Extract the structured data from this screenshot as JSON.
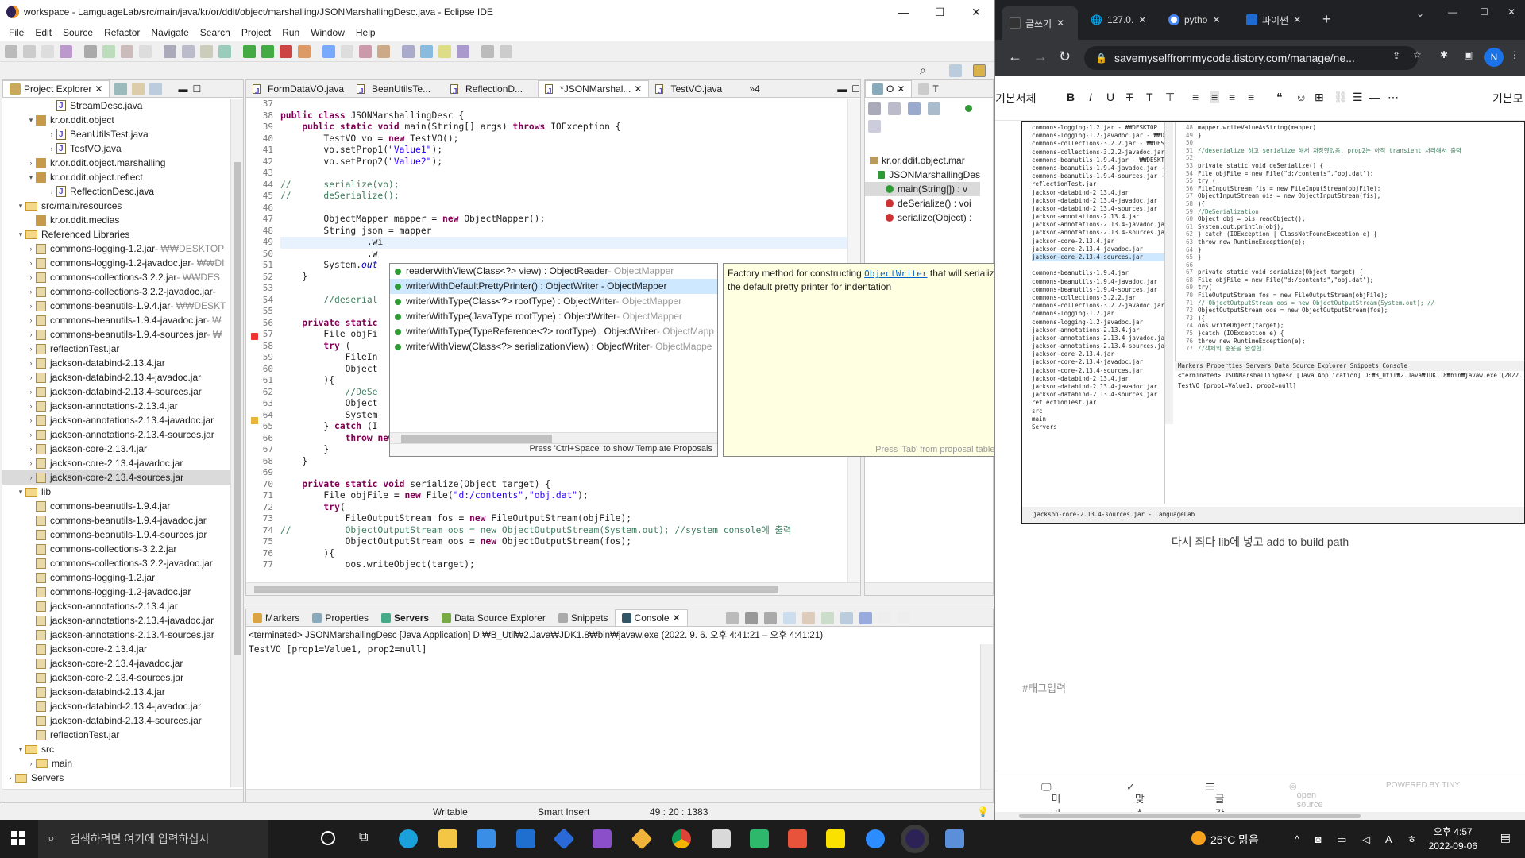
{
  "eclipse": {
    "title": "workspace - LamguageLab/src/main/java/kr/or/ddit/object/marshalling/JSONMarshallingDesc.java - Eclipse IDE",
    "menu": [
      "File",
      "Edit",
      "Source",
      "Refactor",
      "Navigate",
      "Search",
      "Project",
      "Run",
      "Window",
      "Help"
    ],
    "explorer": {
      "title": "Project Explorer",
      "rows": [
        {
          "indent": 4,
          "tw": "",
          "icon": "jfile",
          "label": "StreamDesc.java",
          "suffix": ""
        },
        {
          "indent": 2,
          "tw": "▾",
          "icon": "pkg",
          "label": "kr.or.ddit.object",
          "suffix": ""
        },
        {
          "indent": 4,
          "tw": "›",
          "icon": "jfile",
          "label": "BeanUtilsTest.java",
          "suffix": ""
        },
        {
          "indent": 4,
          "tw": "›",
          "icon": "jfile",
          "label": "TestVO.java",
          "suffix": ""
        },
        {
          "indent": 2,
          "tw": "›",
          "icon": "pkg",
          "label": "kr.or.ddit.object.marshalling",
          "suffix": ""
        },
        {
          "indent": 2,
          "tw": "▾",
          "icon": "pkg",
          "label": "kr.or.ddit.object.reflect",
          "suffix": ""
        },
        {
          "indent": 4,
          "tw": "›",
          "icon": "jfile",
          "label": "ReflectionDesc.java",
          "suffix": ""
        },
        {
          "indent": 1,
          "tw": "▾",
          "icon": "fold",
          "label": "src/main/resources",
          "suffix": ""
        },
        {
          "indent": 2,
          "tw": "",
          "icon": "pkg",
          "label": "kr.or.ddit.medias",
          "suffix": ""
        },
        {
          "indent": 1,
          "tw": "▾",
          "icon": "fold",
          "label": "Referenced Libraries",
          "suffix": ""
        },
        {
          "indent": 2,
          "tw": "›",
          "icon": "jar",
          "label": "commons-logging-1.2.jar",
          "suffix": " - ₩₩DESKTOP"
        },
        {
          "indent": 2,
          "tw": "›",
          "icon": "jar",
          "label": "commons-logging-1.2-javadoc.jar",
          "suffix": " - ₩₩DI"
        },
        {
          "indent": 2,
          "tw": "›",
          "icon": "jar",
          "label": "commons-collections-3.2.2.jar",
          "suffix": " - ₩₩DES"
        },
        {
          "indent": 2,
          "tw": "›",
          "icon": "jar",
          "label": "commons-collections-3.2.2-javadoc.jar",
          "suffix": " -"
        },
        {
          "indent": 2,
          "tw": "›",
          "icon": "jar",
          "label": "commons-beanutils-1.9.4.jar",
          "suffix": " - ₩₩DESKT"
        },
        {
          "indent": 2,
          "tw": "›",
          "icon": "jar",
          "label": "commons-beanutils-1.9.4-javadoc.jar",
          "suffix": " - ₩"
        },
        {
          "indent": 2,
          "tw": "›",
          "icon": "jar",
          "label": "commons-beanutils-1.9.4-sources.jar",
          "suffix": " - ₩"
        },
        {
          "indent": 2,
          "tw": "›",
          "icon": "jar",
          "label": "reflectionTest.jar",
          "suffix": ""
        },
        {
          "indent": 2,
          "tw": "›",
          "icon": "jar",
          "label": "jackson-databind-2.13.4.jar",
          "suffix": ""
        },
        {
          "indent": 2,
          "tw": "›",
          "icon": "jar",
          "label": "jackson-databind-2.13.4-javadoc.jar",
          "suffix": ""
        },
        {
          "indent": 2,
          "tw": "›",
          "icon": "jar",
          "label": "jackson-databind-2.13.4-sources.jar",
          "suffix": ""
        },
        {
          "indent": 2,
          "tw": "›",
          "icon": "jar",
          "label": "jackson-annotations-2.13.4.jar",
          "suffix": ""
        },
        {
          "indent": 2,
          "tw": "›",
          "icon": "jar",
          "label": "jackson-annotations-2.13.4-javadoc.jar",
          "suffix": ""
        },
        {
          "indent": 2,
          "tw": "›",
          "icon": "jar",
          "label": "jackson-annotations-2.13.4-sources.jar",
          "suffix": ""
        },
        {
          "indent": 2,
          "tw": "›",
          "icon": "jar",
          "label": "jackson-core-2.13.4.jar",
          "suffix": ""
        },
        {
          "indent": 2,
          "tw": "›",
          "icon": "jar",
          "label": "jackson-core-2.13.4-javadoc.jar",
          "suffix": ""
        },
        {
          "indent": 2,
          "tw": "›",
          "icon": "jar",
          "label": "jackson-core-2.13.4-sources.jar",
          "suffix": "",
          "sel": true
        },
        {
          "indent": 1,
          "tw": "▾",
          "icon": "fold",
          "label": "lib",
          "suffix": ""
        },
        {
          "indent": 2,
          "tw": "",
          "icon": "jar",
          "label": "commons-beanutils-1.9.4.jar",
          "suffix": ""
        },
        {
          "indent": 2,
          "tw": "",
          "icon": "jar",
          "label": "commons-beanutils-1.9.4-javadoc.jar",
          "suffix": ""
        },
        {
          "indent": 2,
          "tw": "",
          "icon": "jar",
          "label": "commons-beanutils-1.9.4-sources.jar",
          "suffix": ""
        },
        {
          "indent": 2,
          "tw": "",
          "icon": "jar",
          "label": "commons-collections-3.2.2.jar",
          "suffix": ""
        },
        {
          "indent": 2,
          "tw": "",
          "icon": "jar",
          "label": "commons-collections-3.2.2-javadoc.jar",
          "suffix": ""
        },
        {
          "indent": 2,
          "tw": "",
          "icon": "jar",
          "label": "commons-logging-1.2.jar",
          "suffix": ""
        },
        {
          "indent": 2,
          "tw": "",
          "icon": "jar",
          "label": "commons-logging-1.2-javadoc.jar",
          "suffix": ""
        },
        {
          "indent": 2,
          "tw": "",
          "icon": "jar",
          "label": "jackson-annotations-2.13.4.jar",
          "suffix": ""
        },
        {
          "indent": 2,
          "tw": "",
          "icon": "jar",
          "label": "jackson-annotations-2.13.4-javadoc.jar",
          "suffix": ""
        },
        {
          "indent": 2,
          "tw": "",
          "icon": "jar",
          "label": "jackson-annotations-2.13.4-sources.jar",
          "suffix": ""
        },
        {
          "indent": 2,
          "tw": "",
          "icon": "jar",
          "label": "jackson-core-2.13.4.jar",
          "suffix": ""
        },
        {
          "indent": 2,
          "tw": "",
          "icon": "jar",
          "label": "jackson-core-2.13.4-javadoc.jar",
          "suffix": ""
        },
        {
          "indent": 2,
          "tw": "",
          "icon": "jar",
          "label": "jackson-core-2.13.4-sources.jar",
          "suffix": ""
        },
        {
          "indent": 2,
          "tw": "",
          "icon": "jar",
          "label": "jackson-databind-2.13.4.jar",
          "suffix": ""
        },
        {
          "indent": 2,
          "tw": "",
          "icon": "jar",
          "label": "jackson-databind-2.13.4-javadoc.jar",
          "suffix": ""
        },
        {
          "indent": 2,
          "tw": "",
          "icon": "jar",
          "label": "jackson-databind-2.13.4-sources.jar",
          "suffix": ""
        },
        {
          "indent": 2,
          "tw": "",
          "icon": "jar",
          "label": "reflectionTest.jar",
          "suffix": ""
        },
        {
          "indent": 1,
          "tw": "▾",
          "icon": "fold",
          "label": "src",
          "suffix": ""
        },
        {
          "indent": 2,
          "tw": "›",
          "icon": "fold",
          "label": "main",
          "suffix": ""
        },
        {
          "indent": 0,
          "tw": "›",
          "icon": "fold",
          "label": "Servers",
          "suffix": ""
        }
      ]
    },
    "editor_tabs": [
      {
        "label": "FormDataVO.java",
        "active": false
      },
      {
        "label": "BeanUtilsTe...",
        "active": false
      },
      {
        "label": "ReflectionD...",
        "active": false
      },
      {
        "label": "*JSONMarshal...",
        "active": true
      },
      {
        "label": "TestVO.java",
        "active": false
      },
      {
        "label": "»4",
        "active": false
      }
    ],
    "code_lines": [
      {
        "n": "37",
        "t": ""
      },
      {
        "n": "38",
        "t": "public class JSONMarshallingDesc {"
      },
      {
        "n": "39",
        "t": "    public static void main(String[] args) throws IOException {"
      },
      {
        "n": "40",
        "t": "        TestVO vo = new TestVO();"
      },
      {
        "n": "41",
        "t": "        vo.setProp1(\"Value1\");"
      },
      {
        "n": "42",
        "t": "        vo.setProp2(\"Value2\");"
      },
      {
        "n": "43",
        "t": ""
      },
      {
        "n": "44",
        "t": "//      serialize(vo);"
      },
      {
        "n": "45",
        "t": "//      deSerialize();"
      },
      {
        "n": "46",
        "t": ""
      },
      {
        "n": "47",
        "t": "        ObjectMapper mapper = new ObjectMapper();"
      },
      {
        "n": "48",
        "t": "        String json = mapper"
      },
      {
        "n": "49",
        "t": "                .wi"
      },
      {
        "n": "50",
        "t": "                .w"
      },
      {
        "n": "51",
        "t": "        System.out"
      },
      {
        "n": "52",
        "t": "    }"
      },
      {
        "n": "53",
        "t": ""
      },
      {
        "n": "54",
        "t": "        //deserial"
      },
      {
        "n": "55",
        "t": ""
      },
      {
        "n": "56",
        "t": "    private static"
      },
      {
        "n": "57",
        "t": "        File objFi"
      },
      {
        "n": "58",
        "t": "        try ("
      },
      {
        "n": "59",
        "t": "            FileIn"
      },
      {
        "n": "60",
        "t": "            Object"
      },
      {
        "n": "61",
        "t": "        ){"
      },
      {
        "n": "62",
        "t": "            //DeSe"
      },
      {
        "n": "63",
        "t": "            Object"
      },
      {
        "n": "64",
        "t": "            System"
      },
      {
        "n": "65",
        "t": "        } catch (I"
      },
      {
        "n": "66",
        "t": "            throw new RuntimeException(e);"
      },
      {
        "n": "67",
        "t": "        }"
      },
      {
        "n": "68",
        "t": "    }"
      },
      {
        "n": "69",
        "t": ""
      },
      {
        "n": "70",
        "t": "    private static void serialize(Object target) {"
      },
      {
        "n": "71",
        "t": "        File objFile = new File(\"d:/contents\",\"obj.dat\");"
      },
      {
        "n": "72",
        "t": "        try("
      },
      {
        "n": "73",
        "t": "            FileOutputStream fos = new FileOutputStream(objFile);"
      },
      {
        "n": "74",
        "t": "//          ObjectOutputStream oos = new ObjectOutputStream(System.out); //system console에 출력"
      },
      {
        "n": "75",
        "t": "            ObjectOutputStream oos = new ObjectOutputStream(fos);"
      },
      {
        "n": "76",
        "t": "        ){"
      },
      {
        "n": "77",
        "t": "            oos.writeObject(target);"
      }
    ],
    "autocomplete": {
      "items": [
        {
          "main": "readerWithView(Class<?> view) : ObjectReader",
          "gray": " - ObjectMapper"
        },
        {
          "main": "writerWithDefaultPrettyPrinter() : ObjectWriter - ObjectMapper",
          "gray": "",
          "sel": true
        },
        {
          "main": "writerWithType(Class<?> rootType) : ObjectWriter",
          "gray": " - ObjectMapper"
        },
        {
          "main": "writerWithType(JavaType rootType) : ObjectWriter",
          "gray": " - ObjectMapper"
        },
        {
          "main": "writerWithType(TypeReference<?> rootType) : ObjectWriter",
          "gray": " - ObjectMapp"
        },
        {
          "main": "writerWithView(Class<?> serializationView) : ObjectWriter",
          "gray": " - ObjectMappe"
        }
      ],
      "footer": "Press 'Ctrl+Space' to show Template Proposals"
    },
    "doc": {
      "before": "Factory method for constructing ",
      "link": "ObjectWriter",
      "after": " that will serialize objects using the default pretty printer for indentation",
      "footer": "Press 'Tab' from proposal table or click for focus"
    },
    "outline": {
      "tabs": [
        "O",
        "T"
      ],
      "rows": [
        {
          "label": "kr.or.ddit.object.mar",
          "indent": 0
        },
        {
          "label": "JSONMarshallingDes",
          "indent": 1
        },
        {
          "label": "main(String[]) : v",
          "indent": 2,
          "sel": true
        },
        {
          "label": "deSerialize() : voi",
          "indent": 2
        },
        {
          "label": "serialize(Object) :",
          "indent": 2
        }
      ]
    },
    "console_tabs": [
      "Markers",
      "Properties",
      "Servers",
      "Data Source Explorer",
      "Snippets",
      "Console"
    ],
    "console_header": "<terminated> JSONMarshallingDesc [Java Application] D:₩B_Util₩2.Java₩JDK1.8₩bin₩javaw.exe  (2022. 9. 6. 오후 4:41:21 – 오후 4:41:21)",
    "console_output": "TestVO [prop1=Value1, prop2=null]",
    "status": {
      "writable": "Writable",
      "mode": "Smart Insert",
      "pos": "49 : 20 : 1383"
    }
  },
  "browser": {
    "tabs": [
      "글쓰기",
      "127.0.",
      "pytho",
      "파이썬"
    ],
    "url": "savemyselffrommycode.tistory.com/manage/ne...",
    "profile": "N",
    "format_font": "기본서체",
    "format_right": "기본모",
    "caption": "다시 죄다 lib에 넣고 add to build path",
    "tag_placeholder": "#태그입력",
    "bottom": [
      "미리보기",
      "맞춤법",
      "글감검색",
      "open source",
      "POWERED BY TINY"
    ],
    "mini_tree": [
      "commons-logging-1.2.jar - ₩₩DESKTOP",
      "commons-logging-1.2-javadoc.jar - ₩₩DI",
      "commons-collections-3.2.2.jar - ₩₩DES",
      "commons-collections-3.2.2-javadoc.jar",
      "commons-beanutils-1.9.4.jar - ₩₩DESKT",
      "commons-beanutils-1.9.4-javadoc.jar - ₩",
      "commons-beanutils-1.9.4-sources.jar - ₩",
      "reflectionTest.jar",
      "jackson-databind-2.13.4.jar",
      "jackson-databind-2.13.4-javadoc.jar",
      "jackson-databind-2.13.4-sources.jar",
      "jackson-annotations-2.13.4.jar",
      "jackson-annotations-2.13.4-javadoc.jar",
      "jackson-annotations-2.13.4-sources.jar",
      "jackson-core-2.13.4.jar",
      "jackson-core-2.13.4-javadoc.jar",
      "jackson-core-2.13.4-sources.jar",
      "",
      "commons-beanutils-1.9.4.jar",
      "commons-beanutils-1.9.4-javadoc.jar",
      "commons-beanutils-1.9.4-sources.jar",
      "commons-collections-3.2.2.jar",
      "commons-collections-3.2.2-javadoc.jar",
      "commons-logging-1.2.jar",
      "commons-logging-1.2-javadoc.jar",
      "jackson-annotations-2.13.4.jar",
      "jackson-annotations-2.13.4-javadoc.jar",
      "jackson-annotations-2.13.4-sources.jar",
      "jackson-core-2.13.4.jar",
      "jackson-core-2.13.4-javadoc.jar",
      "jackson-core-2.13.4-sources.jar",
      "jackson-databind-2.13.4.jar",
      "jackson-databind-2.13.4-javadoc.jar",
      "jackson-databind-2.13.4-sources.jar",
      "reflectionTest.jar",
      "src",
      "main",
      "Servers"
    ],
    "mini_code": [
      "        mapper.writeValueAsString(mapper)",
      "    }",
      "",
      "    //deserialize 하고 serialize 해서 저장했었음, prop2는 아직 transient 처리해서 출력",
      "",
      "    private static void deSerialize() {",
      "        File objFile = new File(\"d:/contents\",\"obj.dat\");",
      "        try (",
      "            FileInputStream fis = new FileInputStream(objFile);",
      "            ObjectInputStream ois = new ObjectInputStream(fis);",
      "        ){",
      "            //DeSerialization",
      "            Object obj = ois.readObject();",
      "            System.out.println(obj);",
      "        } catch (IOException | ClassNotFoundException e) {",
      "            throw new RuntimeException(e);",
      "        }",
      "    }",
      "",
      "    private static void serialize(Object target) {",
      "        File objFile = new File(\"d:/contents\",\"obj.dat\");",
      "        try(",
      "            FileOutputStream fos = new FileOutputStream(objFile);",
      "//          ObjectOutputStream oos = new ObjectOutputStream(System.out); //",
      "            ObjectOutputStream oos = new ObjectOutputStream(fos);",
      "        ){",
      "            oos.writeObject(target);",
      "        }catch (IOException e) {",
      "            throw new RuntimeException(e);",
      "            //객체의 송용을 완성한."
    ],
    "mini_lines": [
      "48",
      "49",
      "50",
      "51",
      "52",
      "53",
      "54",
      "55",
      "56",
      "57",
      "58",
      "59",
      "60",
      "61",
      "62",
      "63",
      "64",
      "65",
      "66",
      "67",
      "68",
      "69",
      "70",
      "71",
      "72",
      "73",
      "74",
      "75",
      "76",
      "77"
    ],
    "mini_console_tabs": "Markers  Properties  Servers  Data Source Explorer  Snippets  Console",
    "mini_console_header": "<terminated> JSONMarshallingDesc [Java Application] D:₩B_Util₩2.Java₩JDK1.8₩bin₩javaw.exe (2022. 9. 6.",
    "mini_console_out": "TestVO [prop1=Value1, prop2=null]",
    "mini_status": "jackson-core-2.13.4-sources.jar - LamguageLab"
  },
  "taskbar": {
    "search": "검색하려면 여기에 입력하십시",
    "weather": "25°C 맑음",
    "time": "오후 4:57",
    "date": "2022-09-06"
  }
}
